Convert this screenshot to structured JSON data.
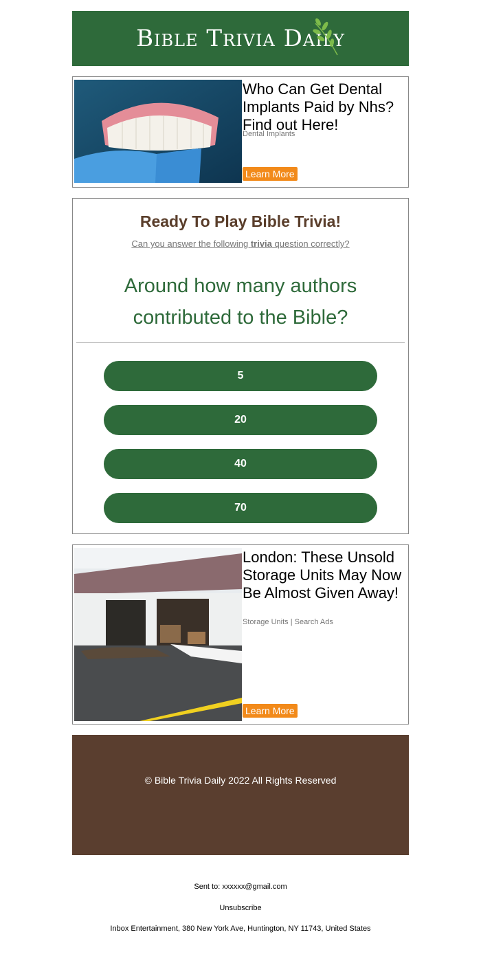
{
  "header": {
    "logo_text": "Bible Trivia Daily",
    "bg_color": "#2e6a3a"
  },
  "ad1": {
    "title": "Who Can Get Dental Implants Paid by Nhs? Find out Here!",
    "subtitle": "Dental Implants",
    "cta": "Learn More"
  },
  "trivia": {
    "heading": "Ready To Play Bible Trivia!",
    "sub_before": "Can you answer the following ",
    "sub_bold": "trivia",
    "sub_after": " question correctly?",
    "question": "Around how many authors contributed to the Bible?",
    "answers": [
      "5",
      "20",
      "40",
      "70"
    ]
  },
  "ad2": {
    "title": "London: These Unsold Storage Units May Now Be Almost Given Away!",
    "subtitle": "Storage Units | Search Ads",
    "cta": "Learn More"
  },
  "footer": {
    "copyright": "© Bible Trivia Daily 2022 All Rights Reserved",
    "bg_color": "#5a3e2f"
  },
  "bottom": {
    "sent_to": "Sent to: xxxxxx@gmail.com",
    "unsubscribe": "Unsubscribe",
    "address": "Inbox Entertainment, 380 New York Ave, Huntington, NY 11743, United States"
  },
  "colors": {
    "accent_green": "#2e6a3a",
    "cta_orange": "#f28a1a",
    "heading_brown": "#5a3e2b"
  }
}
